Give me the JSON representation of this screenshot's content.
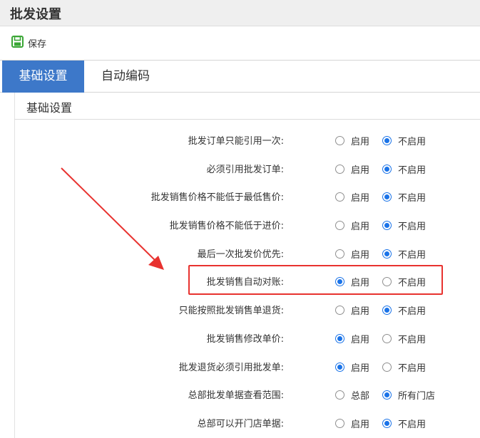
{
  "header": {
    "title": "批发设置"
  },
  "toolbar": {
    "save_label": "保存",
    "save_icon": "save-icon",
    "accent": "#3aa635"
  },
  "tabs": [
    {
      "label": "基础设置",
      "active": true
    },
    {
      "label": "自动编码",
      "active": false
    }
  ],
  "section": {
    "title": "基础设置"
  },
  "settings": [
    {
      "label": "批发订单只能引用一次:",
      "options": [
        "启用",
        "不启用"
      ],
      "selected": 1
    },
    {
      "label": "必须引用批发订单:",
      "options": [
        "启用",
        "不启用"
      ],
      "selected": 1
    },
    {
      "label": "批发销售价格不能低于最低售价:",
      "options": [
        "启用",
        "不启用"
      ],
      "selected": 1
    },
    {
      "label": "批发销售价格不能低于进价:",
      "options": [
        "启用",
        "不启用"
      ],
      "selected": 1
    },
    {
      "label": "最后一次批发价优先:",
      "options": [
        "启用",
        "不启用"
      ],
      "selected": 1
    },
    {
      "label": "批发销售自动对账:",
      "options": [
        "启用",
        "不启用"
      ],
      "selected": 0,
      "highlighted": true
    },
    {
      "label": "只能按照批发销售单退货:",
      "options": [
        "启用",
        "不启用"
      ],
      "selected": 1
    },
    {
      "label": "批发销售修改单价:",
      "options": [
        "启用",
        "不启用"
      ],
      "selected": 0
    },
    {
      "label": "批发退货必须引用批发单:",
      "options": [
        "启用",
        "不启用"
      ],
      "selected": 0
    },
    {
      "label": "总部批发单据查看范围:",
      "options": [
        "总部",
        "所有门店"
      ],
      "selected": 1
    },
    {
      "label": "总部可以开门店单据:",
      "options": [
        "启用",
        "不启用"
      ],
      "selected": 1
    }
  ],
  "colors": {
    "tab_active": "#3d78c9",
    "radio_selected": "#1a73e8",
    "annotation": "#e8322f"
  }
}
